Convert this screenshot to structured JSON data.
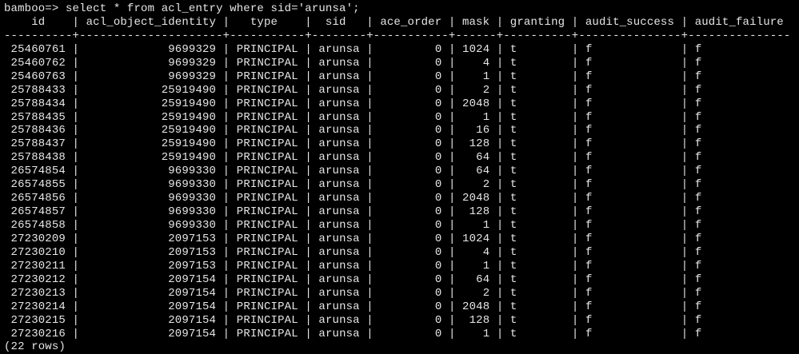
{
  "terminal": {
    "prompt": "bamboo=> ",
    "command": "select * from acl_entry where sid='arunsa';",
    "header_line": "    id    | acl_object_identity |   type    |  sid   | ace_order | mask | granting | audit_success | audit_failure",
    "separator_line": "----------+---------------------+-----------+--------+-----------+------+----------+---------------+---------------",
    "columns": [
      "id",
      "acl_object_identity",
      "type",
      "sid",
      "ace_order",
      "mask",
      "granting",
      "audit_success",
      "audit_failure"
    ],
    "rows": [
      [
        "25460761",
        "9699329",
        "PRINCIPAL",
        "arunsa",
        "0",
        "1024",
        "t",
        "f",
        "f"
      ],
      [
        "25460762",
        "9699329",
        "PRINCIPAL",
        "arunsa",
        "0",
        "4",
        "t",
        "f",
        "f"
      ],
      [
        "25460763",
        "9699329",
        "PRINCIPAL",
        "arunsa",
        "0",
        "1",
        "t",
        "f",
        "f"
      ],
      [
        "25788433",
        "25919490",
        "PRINCIPAL",
        "arunsa",
        "0",
        "2",
        "t",
        "f",
        "f"
      ],
      [
        "25788434",
        "25919490",
        "PRINCIPAL",
        "arunsa",
        "0",
        "2048",
        "t",
        "f",
        "f"
      ],
      [
        "25788435",
        "25919490",
        "PRINCIPAL",
        "arunsa",
        "0",
        "1",
        "t",
        "f",
        "f"
      ],
      [
        "25788436",
        "25919490",
        "PRINCIPAL",
        "arunsa",
        "0",
        "16",
        "t",
        "f",
        "f"
      ],
      [
        "25788437",
        "25919490",
        "PRINCIPAL",
        "arunsa",
        "0",
        "128",
        "t",
        "f",
        "f"
      ],
      [
        "25788438",
        "25919490",
        "PRINCIPAL",
        "arunsa",
        "0",
        "64",
        "t",
        "f",
        "f"
      ],
      [
        "26574854",
        "9699330",
        "PRINCIPAL",
        "arunsa",
        "0",
        "64",
        "t",
        "f",
        "f"
      ],
      [
        "26574855",
        "9699330",
        "PRINCIPAL",
        "arunsa",
        "0",
        "2",
        "t",
        "f",
        "f"
      ],
      [
        "26574856",
        "9699330",
        "PRINCIPAL",
        "arunsa",
        "0",
        "2048",
        "t",
        "f",
        "f"
      ],
      [
        "26574857",
        "9699330",
        "PRINCIPAL",
        "arunsa",
        "0",
        "128",
        "t",
        "f",
        "f"
      ],
      [
        "26574858",
        "9699330",
        "PRINCIPAL",
        "arunsa",
        "0",
        "1",
        "t",
        "f",
        "f"
      ],
      [
        "27230209",
        "2097153",
        "PRINCIPAL",
        "arunsa",
        "0",
        "1024",
        "t",
        "f",
        "f"
      ],
      [
        "27230210",
        "2097153",
        "PRINCIPAL",
        "arunsa",
        "0",
        "4",
        "t",
        "f",
        "f"
      ],
      [
        "27230211",
        "2097153",
        "PRINCIPAL",
        "arunsa",
        "0",
        "1",
        "t",
        "f",
        "f"
      ],
      [
        "27230212",
        "2097154",
        "PRINCIPAL",
        "arunsa",
        "0",
        "64",
        "t",
        "f",
        "f"
      ],
      [
        "27230213",
        "2097154",
        "PRINCIPAL",
        "arunsa",
        "0",
        "2",
        "t",
        "f",
        "f"
      ],
      [
        "27230214",
        "2097154",
        "PRINCIPAL",
        "arunsa",
        "0",
        "2048",
        "t",
        "f",
        "f"
      ],
      [
        "27230215",
        "2097154",
        "PRINCIPAL",
        "arunsa",
        "0",
        "128",
        "t",
        "f",
        "f"
      ],
      [
        "27230216",
        "2097154",
        "PRINCIPAL",
        "arunsa",
        "0",
        "1",
        "t",
        "f",
        "f"
      ]
    ],
    "footer": "(22 rows)",
    "colors": {
      "background": "#000000",
      "text": "#e6e6e6"
    }
  }
}
